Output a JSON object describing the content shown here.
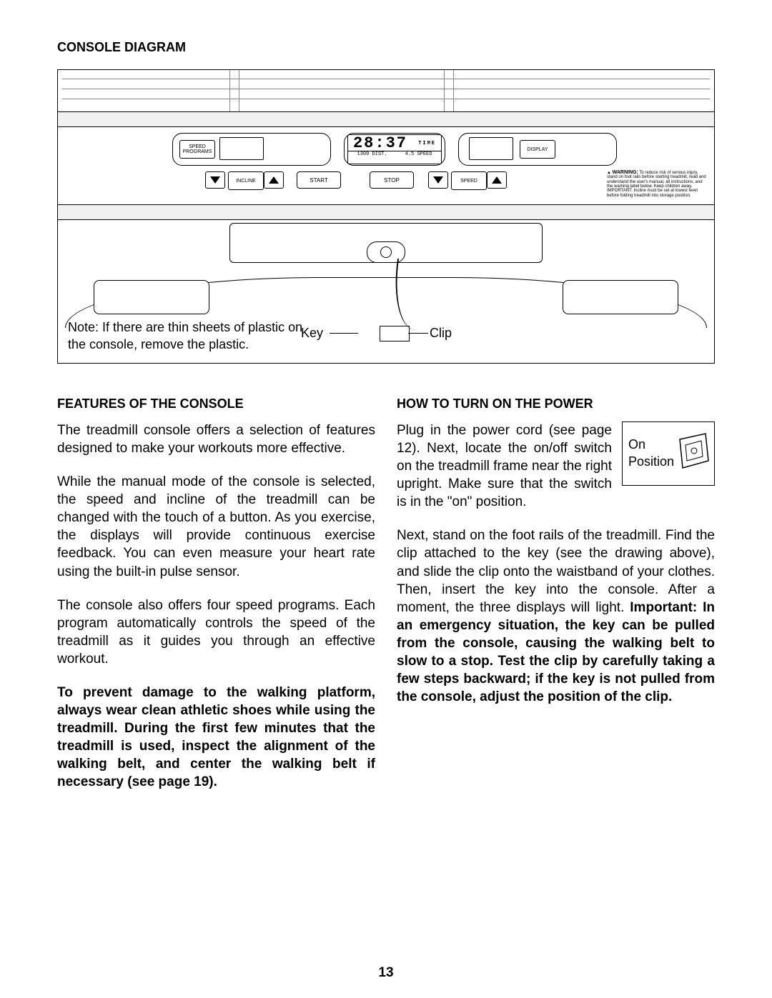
{
  "headings": {
    "diagram": "CONSOLE DIAGRAM",
    "features": "FEATURES OF THE CONSOLE",
    "power": "HOW TO TURN ON THE POWER"
  },
  "console": {
    "speed_programs_label": "SPEED\nPROGRAMS",
    "display_label": "DISPLAY",
    "incline_label": "INCLINE",
    "start_label": "START",
    "stop_label": "STOP",
    "speed_label": "SPEED",
    "lcd_time_value": "28:37",
    "lcd_time_unit": "TIME",
    "lcd_dist_value": "1309",
    "lcd_dist_unit": "DIST.",
    "lcd_speed_value": "4.5",
    "lcd_speed_unit": "SPEED",
    "warning_title": "WARNING:",
    "warning_body": "To reduce risk of serious injury, stand on foot rails before starting treadmill, read and understand the user's manual, all instructions, and the warning label below. Keep children away. IMPORTANT: Incline must be set at lowest level before folding treadmill into storage position."
  },
  "callouts": {
    "key": "Key",
    "clip": "Clip",
    "note": "Note: If there are thin sheets of plastic on the console, remove the plastic."
  },
  "left_col": {
    "p1": "The treadmill console offers a selection of features designed to make your workouts more effective.",
    "p2": "While the manual mode of the console is selected, the speed and incline of the treadmill can be changed with the touch of a button. As you exercise, the displays will provide continuous exercise feedback. You can even measure your heart rate using the built-in pulse sensor.",
    "p3": "The console also offers four speed programs. Each program automatically controls the speed of the treadmill as it guides you through an effective workout.",
    "p4_bold": "To prevent damage to the walking platform, always wear clean athletic shoes while using the treadmill. During the first few minutes that the treadmill is used, inspect the alignment of the walking belt, and center the walking belt if necessary (see page 19)."
  },
  "right_col": {
    "fig_label": "On\nPosition",
    "p1": "Plug in the power cord (see page 12). Next, locate the on/off switch on the treadmill frame near the right upright. Make sure that the switch is in the \"on\" position.",
    "p2_a": "Next, stand on the foot rails of the treadmill. Find the clip attached to the key (see the drawing above), and slide the clip onto the waistband of your clothes. Then, insert the key into the console. After a moment, the three displays will light. ",
    "p2_bold": "Important: In an emergency situation, the key can be pulled from the console, causing the walking belt to slow to a stop. Test the clip by carefully taking a few steps backward; if the key is not pulled from the console, adjust the position of the clip."
  },
  "page_number": "13"
}
